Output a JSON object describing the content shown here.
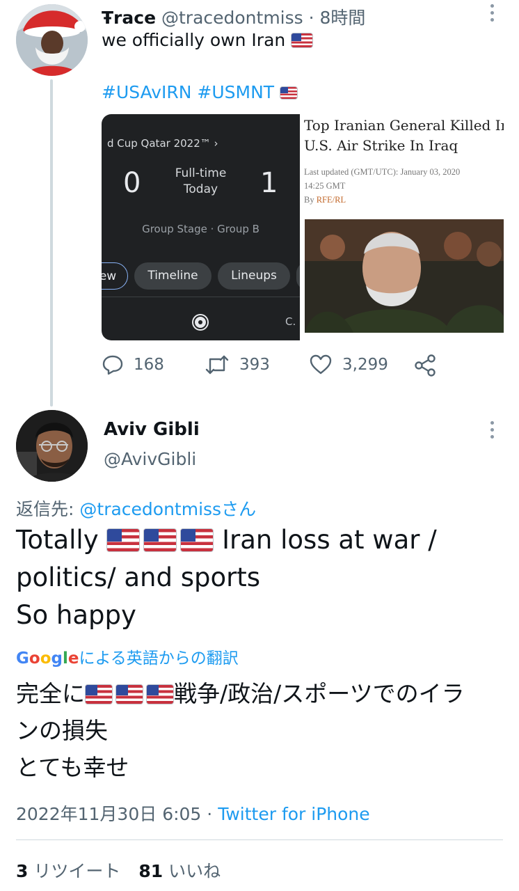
{
  "original_tweet": {
    "author_name": "Ŧrace",
    "handle": "@tracedontmiss",
    "dot": "·",
    "time": "8時間",
    "text": "we officially own Iran",
    "hashtags": "#USAvIRN #USMNT",
    "score_card": {
      "competition": "d Cup Qatar 2022™ ›",
      "home_score": "0",
      "away_score": "1",
      "status_line1": "Full-time",
      "status_line2": "Today",
      "stage": "Group Stage · Group B",
      "chip_overview": "ew",
      "chip_timeline": "Timeline",
      "chip_lineups": "Lineups",
      "trailing_label": "C."
    },
    "news_card": {
      "title_line1": "Top Iranian General Killed In",
      "title_line2": "U.S. Air Strike In Iraq",
      "updated_line1": "Last updated (GMT/UTC): January 03, 2020",
      "updated_line2": "14:25 GMT",
      "by_label": "By",
      "source": "RFE/RL"
    },
    "actions": {
      "replies": "168",
      "retweets": "393",
      "likes": "3,299"
    }
  },
  "reply_tweet": {
    "author_name": "Aviv Gibli",
    "handle": "@AvivGibli",
    "reply_to_label": "返信先:",
    "reply_to_mention": "@tracedontmissさん",
    "body_word1": "Totally",
    "body_rest1": "Iran loss at war /",
    "body_line2": "politics/ and sports",
    "body_line3": "So happy",
    "translate_label": "による英語からの翻訳",
    "trans_word1": "完全に",
    "trans_rest1": "戦争/政治/スポーツでのイラ",
    "trans_line2": "ンの損失",
    "trans_line3": "とても幸せ",
    "timestamp": "2022年11月30日 6:05",
    "meta_dot": "·",
    "client": "Twitter for iPhone",
    "retweet_count": "3",
    "retweet_label": "リツイート",
    "like_count": "81",
    "like_label": "いいね"
  },
  "colors": {
    "link_blue": "#1d9bf0",
    "muted_gray": "#536471",
    "text_black": "#0f1419",
    "thread_line": "#cfd9de"
  },
  "icons": [
    "more-icon",
    "reply-icon",
    "retweet-icon",
    "like-icon",
    "share-icon",
    "us-flag-icon",
    "soccer-ball-icon",
    "google-logo"
  ]
}
